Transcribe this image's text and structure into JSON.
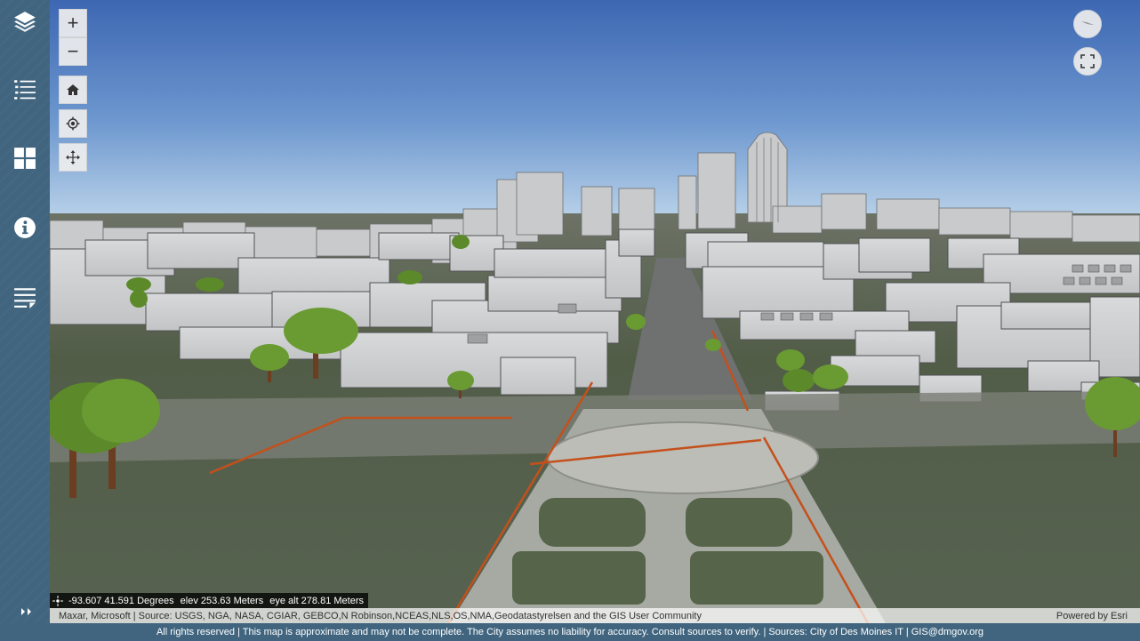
{
  "sidebar": {
    "items": [
      {
        "name": "layers",
        "icon": "layers-icon"
      },
      {
        "name": "legend",
        "icon": "legend-list-icon"
      },
      {
        "name": "basemap-gallery",
        "icon": "grid-icon"
      },
      {
        "name": "about",
        "icon": "info-icon"
      },
      {
        "name": "details",
        "icon": "details-icon"
      }
    ],
    "expand_icon": "double-chevron-right-icon"
  },
  "map_controls": {
    "zoom_in": "+",
    "zoom_out": "−",
    "home_icon": "home-icon",
    "locate_icon": "locate-icon",
    "pan_icon": "pan-move-icon",
    "compass_icon": "compass-icon",
    "fullscreen_icon": "fullscreen-icon"
  },
  "coordinates": {
    "location": "-93.607 41.591 Degrees",
    "elevation": "elev 253.63 Meters",
    "eye_altitude": "eye alt 278.81 Meters"
  },
  "attribution": {
    "sources": "Maxar, Microsoft | Source: USGS, NGA, NASA, CGIAR, GEBCO,N Robinson,NCEAS,NLS,OS,NMA,Geodatastyrelsen and the GIS User Community",
    "powered_by": "Powered by Esri"
  },
  "footer": {
    "disclaimer": "All rights reserved | This map is approximate and may not be complete. The City assumes no liability for accuracy. Consult sources to verify. | Sources: City of Des Moines IT | GIS@dmgov.org"
  },
  "colors": {
    "sidebar_bg": "#41657f",
    "sky_top": "#3f6cb7",
    "sky_horizon": "#b9d2ea",
    "building": "#cfd0d2",
    "parcel_line": "#c4501c",
    "tree": "#5e8a2c"
  }
}
